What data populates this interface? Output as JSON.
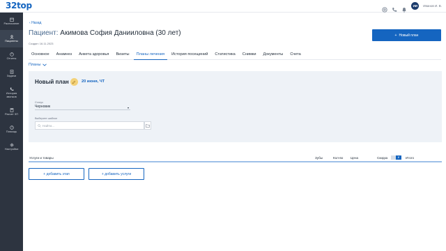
{
  "app": {
    "logo": "32top"
  },
  "user": {
    "initials": "ИИ",
    "name": "Иванов И. В."
  },
  "sidebar": {
    "items": [
      {
        "label": "Расписание",
        "icon": "calendar-icon",
        "active": false
      },
      {
        "label": "Пациенты",
        "icon": "person-icon",
        "active": true
      },
      {
        "label": "Отчеты",
        "icon": "report-icon",
        "active": false
      },
      {
        "label": "Задачи",
        "icon": "tasks-icon",
        "active": false
      },
      {
        "label": "История звонков",
        "icon": "phone-icon",
        "active": false
      },
      {
        "label": "Расчет ЗП",
        "icon": "calculator-icon",
        "active": false
      },
      {
        "label": "Помощь",
        "icon": "help-icon",
        "active": false
      },
      {
        "label": "Настройки",
        "icon": "gear-icon",
        "active": false
      }
    ]
  },
  "header": {
    "back": "Назад",
    "title_prefix": "Пациент:",
    "patient": "Акимова София Данииловна (30 лет)",
    "created": "Создан: 16.11.2023",
    "new_plan_button": "Новый план"
  },
  "tabs": [
    {
      "label": "Основное",
      "active": false
    },
    {
      "label": "Анамнез",
      "active": false
    },
    {
      "label": "Анкета здоровья",
      "active": false
    },
    {
      "label": "Визиты",
      "active": false
    },
    {
      "label": "Планы лечения",
      "active": true
    },
    {
      "label": "История посещений",
      "active": false
    },
    {
      "label": "Статистика",
      "active": false
    },
    {
      "label": "Снимки",
      "active": false
    },
    {
      "label": "Документы",
      "active": false
    },
    {
      "label": "Счета",
      "active": false
    }
  ],
  "plans_dropdown": "Планы",
  "plan": {
    "title": "Новый план",
    "date": "20 июня, ЧТ",
    "status_label": "Статус",
    "status_value": "Черновик",
    "template_label": "Выберите шаблон",
    "search_placeholder": "Найти..."
  },
  "table": {
    "col_services": "Услуги и товары",
    "col_teeth": "Зубы",
    "col_qty": "Кол-во",
    "col_price": "Цена",
    "col_discount": "Скидка",
    "discount_toggle_selected": "₽",
    "col_total": "Итого"
  },
  "actions": {
    "add_stage": "+ добавить этап",
    "add_service": "+ добавить услуги"
  },
  "colors": {
    "accent": "#1565c0",
    "sidebar": "#2d3440",
    "panel": "#eef2f7"
  }
}
